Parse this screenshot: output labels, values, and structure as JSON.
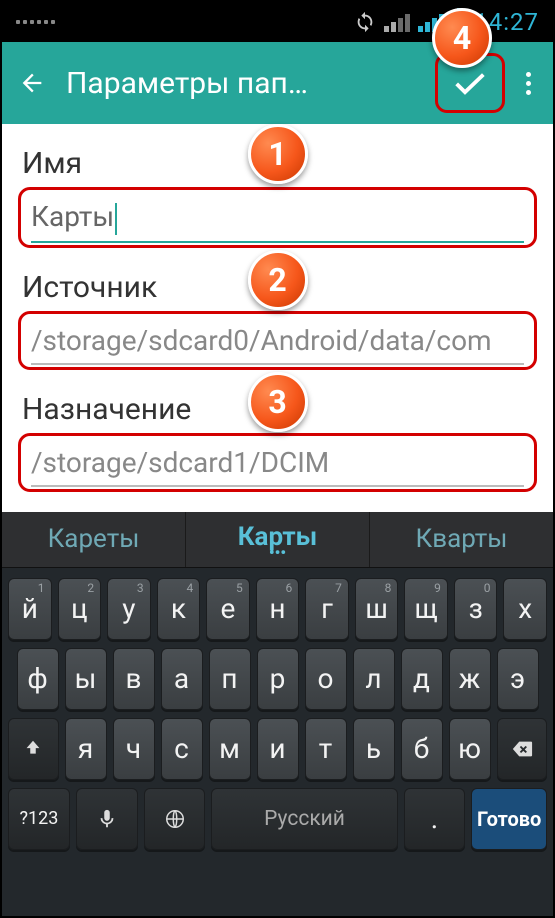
{
  "status": {
    "time": "14:27"
  },
  "appbar": {
    "title": "Параметры пап…"
  },
  "callouts": [
    "1",
    "2",
    "3",
    "4"
  ],
  "form": {
    "name": {
      "label": "Имя",
      "value": "Карты"
    },
    "source": {
      "label": "Источник",
      "value": "/storage/sdcard0/Android/data/com"
    },
    "dest": {
      "label": "Назначение",
      "value": "/storage/sdcard1/DCIM"
    }
  },
  "keyboard": {
    "suggestions": [
      "Кареты",
      "Карты",
      "Кварты"
    ],
    "row1": [
      {
        "k": "й",
        "a": "1"
      },
      {
        "k": "ц",
        "a": "2"
      },
      {
        "k": "у",
        "a": "3"
      },
      {
        "k": "к",
        "a": "4"
      },
      {
        "k": "е",
        "a": "5"
      },
      {
        "k": "н",
        "a": "6"
      },
      {
        "k": "г",
        "a": "7"
      },
      {
        "k": "ш",
        "a": "8"
      },
      {
        "k": "щ",
        "a": "9"
      },
      {
        "k": "з",
        "a": "0"
      },
      {
        "k": "х",
        "a": ""
      }
    ],
    "row2": [
      {
        "k": "ф"
      },
      {
        "k": "ы"
      },
      {
        "k": "в"
      },
      {
        "k": "а"
      },
      {
        "k": "п"
      },
      {
        "k": "р"
      },
      {
        "k": "о"
      },
      {
        "k": "л"
      },
      {
        "k": "д"
      },
      {
        "k": "ж"
      },
      {
        "k": "э"
      }
    ],
    "row3_letters": [
      {
        "k": "я"
      },
      {
        "k": "ч"
      },
      {
        "k": "с"
      },
      {
        "k": "м"
      },
      {
        "k": "и"
      },
      {
        "k": "т"
      },
      {
        "k": "ь"
      },
      {
        "k": "б"
      },
      {
        "k": "ю"
      }
    ],
    "row4": {
      "numbers_label": "?123",
      "lang_label": "Русский",
      "punct_label": ".",
      "done_label": "Готово"
    }
  }
}
